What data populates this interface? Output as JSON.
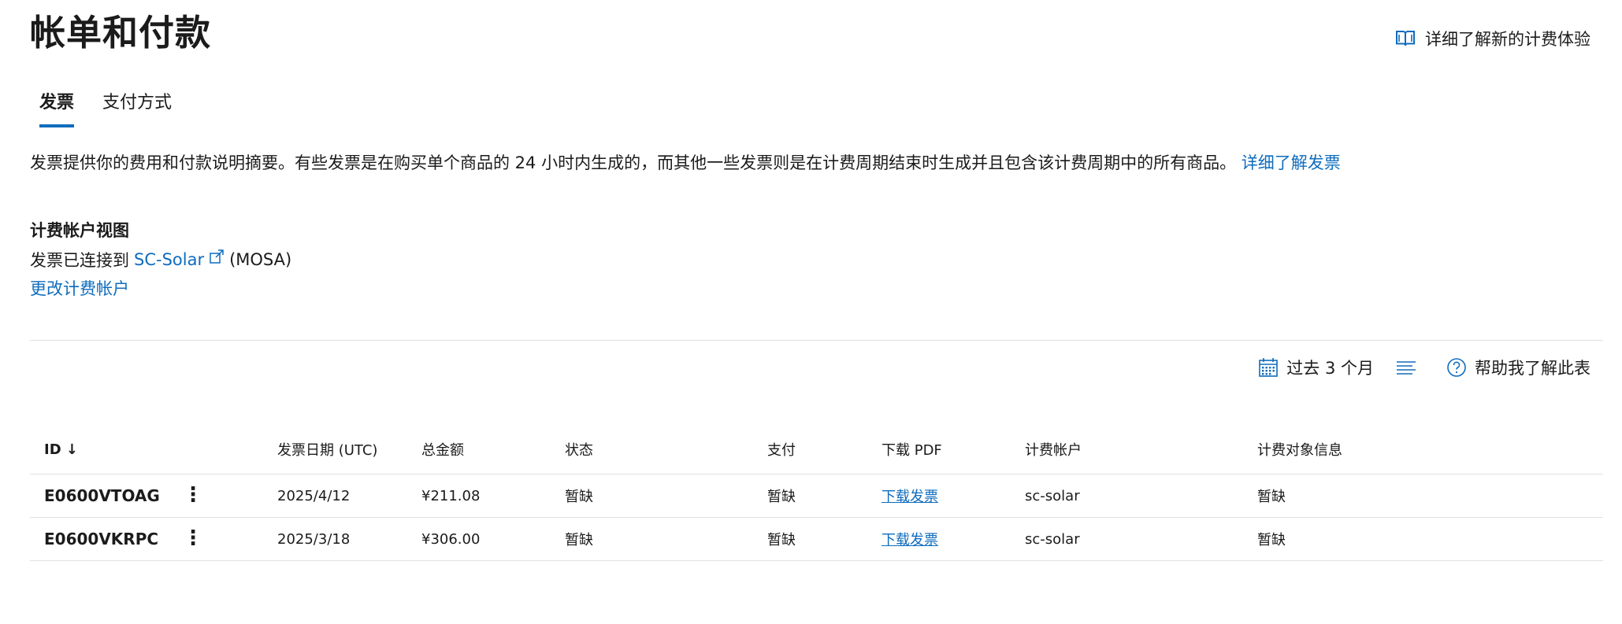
{
  "header": {
    "title": "帐单和付款",
    "learn_more": "详细了解新的计费体验"
  },
  "tabs": [
    {
      "label": "发票",
      "active": true
    },
    {
      "label": "支付方式",
      "active": false
    }
  ],
  "description": {
    "text": "发票提供你的费用和付款说明摘要。有些发票是在购买单个商品的 24 小时内生成的，而其他一些发票则是在计费周期结束时生成并且包含该计费周期中的所有商品。",
    "link": "详细了解发票"
  },
  "billing_account": {
    "section_title": "计费帐户视图",
    "connected_prefix": "发票已连接到",
    "account_name": "SC-Solar",
    "account_suffix": "(MOSA)",
    "change_link": "更改计费帐户"
  },
  "toolbar": {
    "date_filter": "过去 3 个月",
    "help": "帮助我了解此表"
  },
  "table": {
    "headers": {
      "id": "ID ↓",
      "date": "发票日期 (UTC)",
      "total": "总金额",
      "status": "状态",
      "payment": "支付",
      "pdf": "下载 PDF",
      "account": "计费帐户",
      "bill_to": "计费对象信息"
    },
    "rows": [
      {
        "id": "E0600VTOAG",
        "more": "⋮",
        "date": "2025/4/12",
        "total": "¥211.08",
        "status": "暂缺",
        "payment": "暂缺",
        "pdf": "下载发票",
        "account": "sc-solar",
        "bill_to": "暂缺"
      },
      {
        "id": "E0600VKRPC",
        "more": "⋮",
        "date": "2025/3/18",
        "total": "¥306.00",
        "status": "暂缺",
        "payment": "暂缺",
        "pdf": "下载发票",
        "account": "sc-solar",
        "bill_to": "暂缺"
      }
    ]
  },
  "colors": {
    "accent": "#0f6cbd",
    "text": "#1b1b1b",
    "divider": "#e1e1e1"
  }
}
